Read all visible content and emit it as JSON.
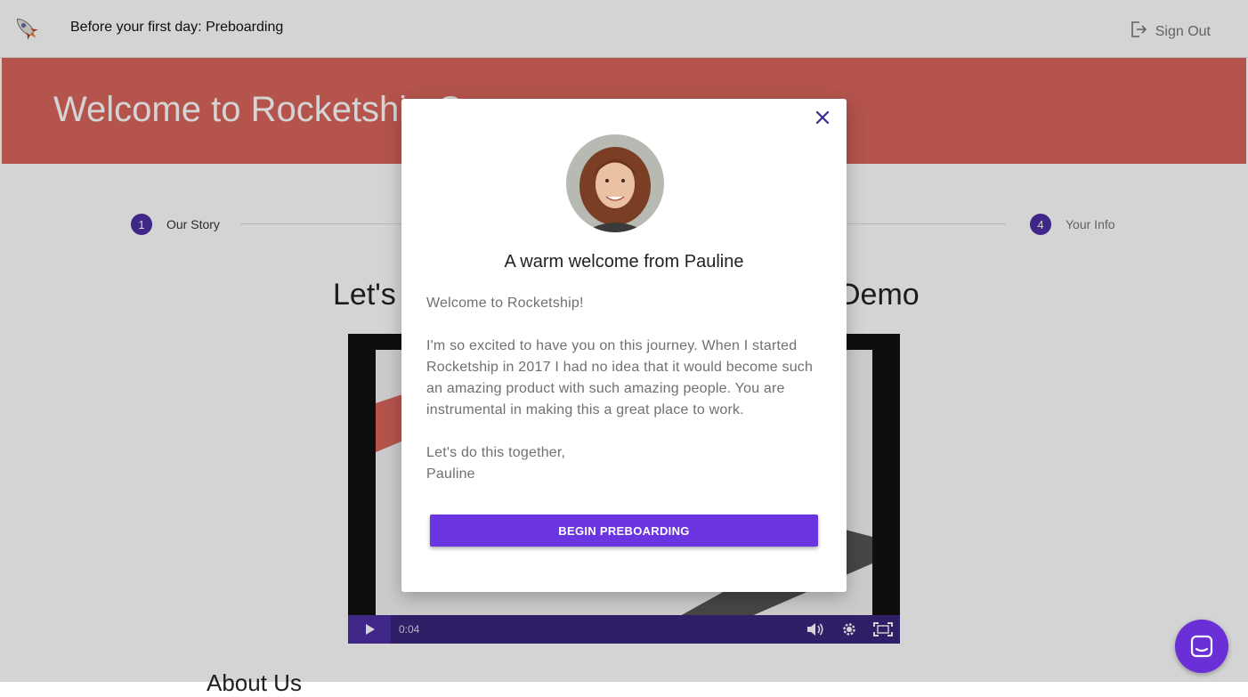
{
  "header": {
    "app_title": "Before your first day: Preboarding",
    "signout_label": "Sign Out"
  },
  "hero": {
    "title": "Welcome to Rocketship C"
  },
  "stepper": {
    "steps": [
      {
        "number": "1",
        "label": "Our Story"
      },
      {
        "number": "4",
        "label": "Your Info"
      }
    ]
  },
  "section": {
    "title_left": "Let's",
    "title_right": "Demo"
  },
  "video": {
    "time": "0:04",
    "icons": [
      "play-icon",
      "volume-icon",
      "settings-icon",
      "fullscreen-icon"
    ]
  },
  "about": {
    "heading": "About Us"
  },
  "modal": {
    "title": "A warm welcome from Pauline",
    "body": {
      "line1": "Welcome to Rocketship!",
      "paragraph": "I'm so excited to have you on this journey. When I started Rocketship in 2017 I had no idea that it would become such an amazing product with such amazing people. You are instrumental in making this a great place to work.",
      "signoff1": "Let's do this together,",
      "signoff2": "Pauline"
    },
    "button_label": "BEGIN PREBOARDING"
  },
  "colors": {
    "hero": "#d9665c",
    "accent": "#6a35e0",
    "step": "#4b2fa3"
  }
}
